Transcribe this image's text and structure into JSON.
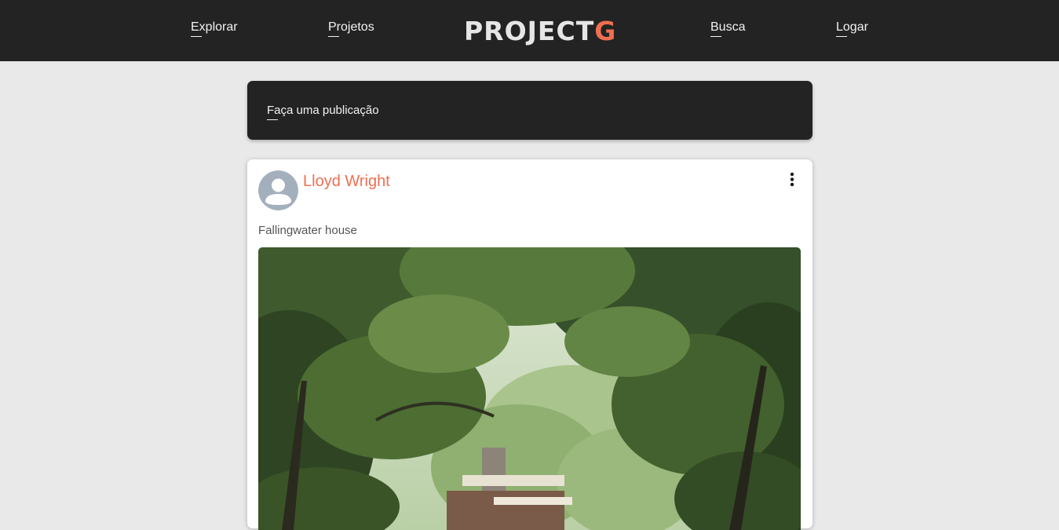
{
  "nav": {
    "items": [
      {
        "label": "Explorar"
      },
      {
        "label": "Projetos"
      },
      {
        "label": "Busca"
      },
      {
        "label": "Logar"
      }
    ],
    "logo_main": "PROJECT",
    "logo_accent": "G"
  },
  "compose": {
    "label": "Faça uma publicação"
  },
  "post": {
    "author": "Lloyd Wright",
    "caption": "Fallingwater house",
    "image_subject": "Fallingwater house among trees"
  },
  "colors": {
    "header_bg": "#232323",
    "page_bg": "#e9e9e9",
    "accent": "#f06e50",
    "card_bg": "#ffffff",
    "avatar": "#a4afbe"
  },
  "icons": {
    "avatar": "user-placeholder-icon",
    "menu": "more-vertical-icon"
  }
}
